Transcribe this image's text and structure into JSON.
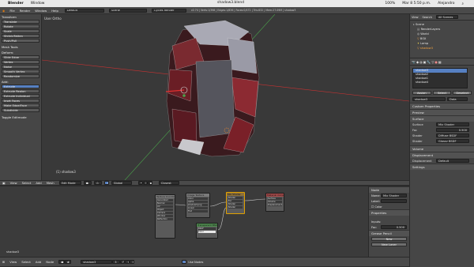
{
  "mac_menubar": {
    "app_name": "Blender",
    "window_menu": "Window",
    "status_right": [
      "100%",
      "Mar 8 5:50 p.m.",
      "Alejandro"
    ]
  },
  "info_header": {
    "menus": [
      "File",
      "Render",
      "Window",
      "Help"
    ],
    "layout": "Default",
    "scene": "Scene",
    "engine": "Cycles Render",
    "stats": "v2.74 | Verts:1/398 | Edges:1/836 | Faces:0/472 | Tris:832 | Mem:27.09M | shadow3"
  },
  "title_bar": {
    "file_title": "shadow3.blend"
  },
  "tool_shelf": {
    "transform_title": "Transform",
    "transform_buttons": [
      "Translate",
      "Rotate",
      "Scale",
      "Shrink/Fatten",
      "Push/Pull"
    ],
    "mesh_tools_title": "Mesh Tools",
    "deform_label": "Deform:",
    "deform_buttons": [
      "Slide Edge",
      "Vertex",
      "Noise",
      "Smooth Vertex",
      "Randomize"
    ],
    "add_label": "Add:",
    "add_buttons": [
      "Extrude",
      "Extrude Region",
      "Extrude Individual",
      "Inset Faces",
      "Make Edge/Face",
      "Subdivide"
    ],
    "operator_title": "Toggle Editmode"
  },
  "viewport": {
    "view_label": "User Ortho",
    "object_label": "(1) shadow3",
    "colors": {
      "mesh_dark": "#3a1a1e",
      "mesh_light": "#a9a9b4",
      "axis_red": "#c83232",
      "axis_green": "#4aa04a"
    }
  },
  "viewport_header": {
    "menus": [
      "View",
      "Select",
      "Add",
      "Mesh"
    ],
    "mode": "Edit Mode",
    "pivot": "Global",
    "snap": "Closest"
  },
  "node_editor": {
    "nodes": [
      {
        "title": "Texture Coordinate",
        "rows": [
          "Generated",
          "Normal",
          "UV",
          "Object",
          "Camera",
          "Window",
          "Reflection"
        ]
      },
      {
        "title": "Image Texture",
        "rows": [
          "Color",
          "Alpha",
          "shadow3.png",
          "Linear",
          "Flat"
        ]
      },
      {
        "title": "Mix Shader",
        "rows": [
          "Shader",
          "Fac",
          "Shader",
          "Shader"
        ]
      },
      {
        "title": "Material Output",
        "rows": [
          "Surface",
          "Volume",
          "Displacement"
        ]
      },
      {
        "title": "Transparent BSDF",
        "rows": [
          "BSDF",
          "Color"
        ]
      }
    ],
    "footer_label": "shadow3"
  },
  "node_editor_header": {
    "menus": [
      "View",
      "Select",
      "Add",
      "Node"
    ],
    "material": "shadow3",
    "use_nodes_label": "Use Nodes"
  },
  "node_sidebar": {
    "node_title": "Node",
    "name_label": "Name:",
    "name_value": "Mix Shader",
    "label_label": "Label:",
    "color_label": "Color",
    "properties_title": "Properties",
    "inputs_title": "Inputs:",
    "fac_label": "Fac:",
    "fac_value": "0.500",
    "grease_title": "Grease Pencil",
    "new_button": "New",
    "new_layer_button": "New Layer"
  },
  "outliner": {
    "header_tabs": [
      "View",
      "Search",
      "All Scenes"
    ],
    "items": [
      "Scene",
      "RenderLayers",
      "World",
      "BOX",
      "Lamp",
      "shadow3"
    ]
  },
  "properties": {
    "material_slots": [
      "shadow3",
      "shadow2",
      "shadow1",
      "shadow4"
    ],
    "slot_buttons": [
      "Assign",
      "Select",
      "Deselect"
    ],
    "material_name": "shadow3",
    "data_label": "Data",
    "sections": [
      "Custom Properties",
      "Preview",
      "Surface"
    ],
    "surface_label": "Surface",
    "surface_value": "Mix Shader",
    "fac_label": "Fac",
    "fac_value": "0.500",
    "shader1_label": "Shader",
    "shader1_value": "Diffuse BSDF",
    "shader2_label": "Shader",
    "shader2_value": "Glossy BSDF",
    "volume_title": "Volume",
    "displacement_title": "Displacement",
    "displacement_label": "Displacement",
    "displacement_value": "Default",
    "settings_title": "Settings"
  }
}
